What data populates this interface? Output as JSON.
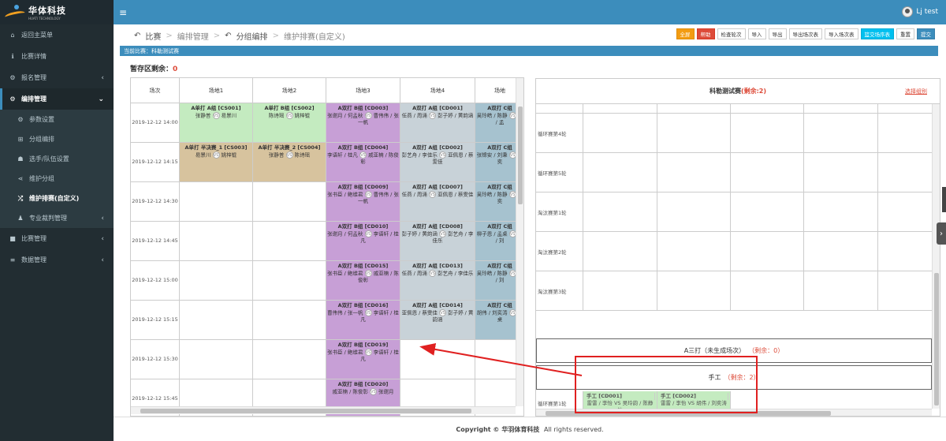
{
  "brand": {
    "name": "华体科技",
    "tagline": "HUATI TECHNOLOGY"
  },
  "user": {
    "name": "Lj test"
  },
  "sidebar": {
    "items": [
      {
        "label": "返回主菜单",
        "icon": "home-icon"
      },
      {
        "label": "比赛详情",
        "icon": "info-icon"
      },
      {
        "label": "报名管理",
        "icon": "cogs-icon",
        "chev": "‹"
      },
      {
        "label": "编排管理",
        "icon": "gear-icon",
        "chev": "⌄"
      },
      {
        "label": "参数设置",
        "icon": "gear-icon",
        "sub": true
      },
      {
        "label": "分组编排",
        "icon": "sitemap-icon",
        "sub": true
      },
      {
        "label": "选手/队伍设置",
        "icon": "user-icon",
        "sub": true
      },
      {
        "label": "维护分组",
        "icon": "share-icon",
        "sub": true
      },
      {
        "label": "维护排赛(自定义)",
        "icon": "random-icon",
        "sub": true,
        "current": true
      },
      {
        "label": "专业裁判管理",
        "icon": "users-icon",
        "sub": true,
        "chev": "‹"
      },
      {
        "label": "比赛管理",
        "icon": "square-icon",
        "chev": "‹"
      },
      {
        "label": "数据管理",
        "icon": "database-icon",
        "chev": "‹"
      }
    ]
  },
  "breadcrumb": {
    "c1": "比赛",
    "c2": "编排管理",
    "c3": "分组编排",
    "c4": "维护排赛(自定义)"
  },
  "toolbar": [
    "全屏",
    "帮助",
    "检查轮次",
    "导入",
    "导出",
    "导出场次表",
    "导入场次表",
    "篮交场序表",
    "重置",
    "提交"
  ],
  "match_label": "当前比赛：科勒测试赛",
  "remain": {
    "label": "暂存区剩余：",
    "value": "0"
  },
  "schedule": {
    "headers": [
      "场次",
      "场地1",
      "场地2",
      "场地3",
      "场地4",
      "场地"
    ],
    "rows": [
      {
        "time": "2019-12-12 14:00",
        "cells": [
          {
            "c": "green",
            "t": "A单打 A组 [CS001]",
            "p1": "张静普",
            "p2": "易景川"
          },
          {
            "c": "green",
            "t": "A单打 B组 [CS002]",
            "p1": "陈诗瑶",
            "p2": "姚梓锟"
          },
          {
            "c": "purple",
            "t": "A双打 B组 [CD003]",
            "p1": "张谢月 / 何孟秋",
            "p2": "曹伟伟 / 张一帆"
          },
          {
            "c": "gray",
            "t": "A双打 A组 [CD001]",
            "p1": "任燕 / 周涌",
            "p2": "彭子婷 / 黄韵涵"
          },
          {
            "c": "blueg",
            "t": "A双打 C组",
            "p1": "吴玲皓 / 陈静",
            "p2": "恩 / 孟"
          }
        ]
      },
      {
        "time": "2019-12-12 14:15",
        "cells": [
          {
            "c": "tan",
            "t": "A单打 半决赛_1 [CS003]",
            "p1": "易景川",
            "p2": "姚梓锟"
          },
          {
            "c": "tan",
            "t": "A单打 半决赛_2 [CS004]",
            "p1": "张静普",
            "p2": "陈诗瑶"
          },
          {
            "c": "purple",
            "t": "A双打 B组 [CD004]",
            "p1": "李语轩 / 桂凡",
            "p2": "戚亚楠 / 陈俊彰"
          },
          {
            "c": "gray",
            "t": "A双打 A组 [CD002]",
            "p1": "彭艺舟 / 李佳乐",
            "p2": "亚佩恩 / 蔡雯佳"
          },
          {
            "c": "blueg",
            "t": "A双打 C组",
            "p1": "张锦安 / 刘秉",
            "p2": "刘奕"
          }
        ]
      },
      {
        "time": "2019-12-12 14:30",
        "cells": [
          {
            "c": "",
            "t": "",
            "p1": "",
            "p2": ""
          },
          {
            "c": "",
            "t": "",
            "p1": "",
            "p2": ""
          },
          {
            "c": "purple",
            "t": "A双打 B组 [CD009]",
            "p1": "张书臣 / 鲍维君",
            "p2": "曹伟伟 / 张一帆"
          },
          {
            "c": "gray",
            "t": "A双打 A组 [CD007]",
            "p1": "任燕 / 周涌",
            "p2": "亚佩恩 / 蔡雯佳"
          },
          {
            "c": "blueg",
            "t": "A双打 C组",
            "p1": "吴玲皓 / 陈静",
            "p2": "刘奕"
          }
        ]
      },
      {
        "time": "2019-12-12 14:45",
        "cells": [
          {
            "c": "",
            "t": "",
            "p1": "",
            "p2": ""
          },
          {
            "c": "",
            "t": "",
            "p1": "",
            "p2": ""
          },
          {
            "c": "purple",
            "t": "A双打 B组 [CD010]",
            "p1": "张谢月 / 何孟秋",
            "p2": "李语轩 / 桂凡"
          },
          {
            "c": "gray",
            "t": "A双打 A组 [CD008]",
            "p1": "彭子婷 / 黄韵涵",
            "p2": "彭艺舟 / 李佳乐"
          },
          {
            "c": "blueg",
            "t": "A双打 C组",
            "p1": "柳子恩 / 孟桌",
            "p2": "安 / 刘"
          }
        ]
      },
      {
        "time": "2019-12-12 15:00",
        "cells": [
          {
            "c": "",
            "t": "",
            "p1": "",
            "p2": ""
          },
          {
            "c": "",
            "t": "",
            "p1": "",
            "p2": ""
          },
          {
            "c": "purple",
            "t": "A双打 B组 [CD015]",
            "p1": "张书臣 / 鲍维君",
            "p2": "戚亚楠 / 陈俊彰"
          },
          {
            "c": "gray",
            "t": "A双打 A组 [CD013]",
            "p1": "任燕 / 周涌",
            "p2": "彭艺舟 / 李佳乐"
          },
          {
            "c": "blueg",
            "t": "A双打 C组",
            "p1": "吴玲皓 / 陈静",
            "p2": "安 / 刘"
          }
        ]
      },
      {
        "time": "2019-12-12 15:15",
        "cells": [
          {
            "c": "",
            "t": "",
            "p1": "",
            "p2": ""
          },
          {
            "c": "",
            "t": "",
            "p1": "",
            "p2": ""
          },
          {
            "c": "purple",
            "t": "A双打 B组 [CD016]",
            "p1": "曹伟伟 / 张一帆",
            "p2": "李语轩 / 桂凡"
          },
          {
            "c": "gray",
            "t": "A双打 A组 [CD014]",
            "p1": "亚佩恩 / 蔡雯佳",
            "p2": "彭子婷 / 黄韵涵"
          },
          {
            "c": "blueg",
            "t": "A双打 C组",
            "p1": "胡伟 / 刘奕涛",
            "p2": "孟桌"
          }
        ]
      },
      {
        "time": "2019-12-12 15:30",
        "cells": [
          {
            "c": "",
            "t": "",
            "p1": "",
            "p2": ""
          },
          {
            "c": "",
            "t": "",
            "p1": "",
            "p2": ""
          },
          {
            "c": "purple",
            "t": "A双打 B组 [CD019]",
            "p1": "张书臣 / 鲍维君",
            "p2": "李语轩 / 桂凡"
          },
          {
            "c": "",
            "t": "",
            "p1": "",
            "p2": ""
          },
          {
            "c": "",
            "t": "",
            "p1": "",
            "p2": ""
          }
        ]
      },
      {
        "time": "2019-12-12 15:45",
        "cells": [
          {
            "c": "",
            "t": "",
            "p1": "",
            "p2": ""
          },
          {
            "c": "",
            "t": "",
            "p1": "",
            "p2": ""
          },
          {
            "c": "purple",
            "t": "A双打 B组 [CD020]",
            "p1": "戚亚楠 / 陈俊彰",
            "p2": "张谢月"
          },
          {
            "c": "",
            "t": "",
            "p1": "",
            "p2": ""
          },
          {
            "c": "",
            "t": "",
            "p1": "",
            "p2": ""
          }
        ]
      }
    ]
  },
  "pool": {
    "title": "科勒测试赛",
    "count": "(剩余:2)",
    "link": "选择组别",
    "rounds": [
      "循环赛第4轮",
      "循环赛第5轮",
      "淘汰赛第1轮",
      "淘汰赛第2轮",
      "淘汰赛第3轮"
    ],
    "strip1": {
      "label": "A三打（未生成场次）",
      "count": "（剩余：0）"
    },
    "strip2": {
      "label": "手工",
      "count": "（剩余：2）"
    },
    "last_round": "循环赛第1轮",
    "matches": [
      {
        "t": "手工 [CD001]",
        "p1": "雷雷 / 李怡",
        "p2": "吴玲韵 / 陈静怡"
      },
      {
        "t": "手工 [CD002]",
        "p1": "雷雷 / 李怡",
        "p2": "胡伟 / 刘奕涛"
      }
    ]
  },
  "footer": {
    "prefix": "Copyright ©",
    "company": "华羽体育科技",
    "suffix": "All rights reserved."
  },
  "colors": {
    "primary": "#3c8dbc",
    "sidebar": "#222d32",
    "danger": "#dd4b39",
    "annotation": "#e02020"
  }
}
